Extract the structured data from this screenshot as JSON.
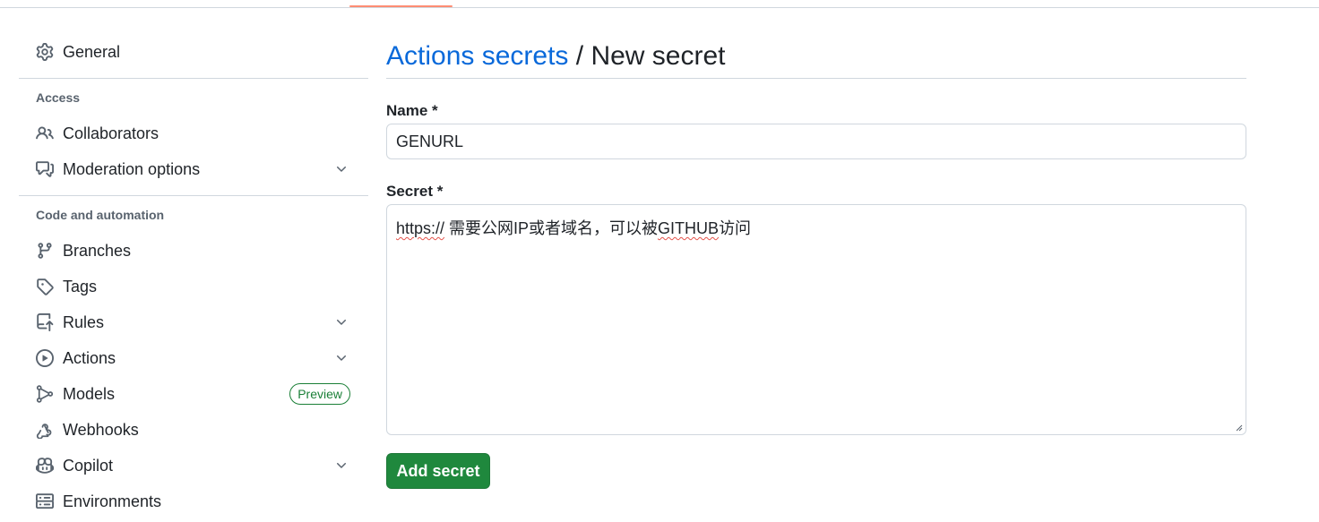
{
  "sidebar": {
    "general": "General",
    "access_title": "Access",
    "access_items": [
      "Collaborators",
      "Moderation options"
    ],
    "code_title": "Code and automation",
    "code_items": [
      "Branches",
      "Tags",
      "Rules",
      "Actions",
      "Models",
      "Webhooks",
      "Copilot",
      "Environments"
    ],
    "models_badge": "Preview"
  },
  "header": {
    "crumb_link": "Actions secrets",
    "separator": "/",
    "current": "New secret"
  },
  "form": {
    "name_label": "Name *",
    "name_value": "GENURL",
    "secret_label": "Secret *",
    "secret_value_part1": "https://",
    "secret_value_part2": "  需要公网IP或者域名，可以被",
    "secret_value_part3": "GITHUB",
    "secret_value_part4": "访问",
    "submit_label": "Add secret"
  },
  "colors": {
    "accent": "#0969da",
    "button": "#1f883d",
    "tab_underline": "#fd8c73"
  }
}
